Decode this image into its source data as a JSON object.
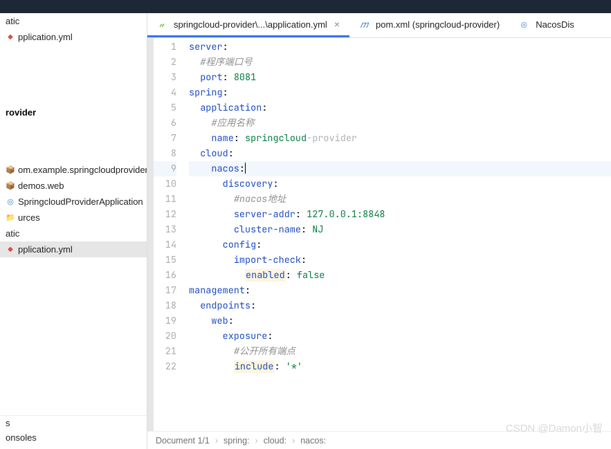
{
  "sidebar": {
    "upper_items": [
      {
        "label": "atic",
        "class": ""
      },
      {
        "label": "pplication.yml",
        "class": "yml"
      }
    ],
    "heading": "rovider",
    "tree_items": [
      {
        "label": "om.example.springcloudprovider",
        "class": "pkg"
      },
      {
        "label": "demos.web",
        "class": "pkg"
      },
      {
        "label": "SpringcloudProviderApplication",
        "class": "java"
      },
      {
        "label": "urces",
        "class": "folder"
      },
      {
        "label": "atic",
        "class": ""
      },
      {
        "label": "pplication.yml",
        "class": "yml",
        "selected": true
      }
    ],
    "bottom_items": [
      {
        "label": "s"
      },
      {
        "label": "onsoles"
      }
    ]
  },
  "tabs": [
    {
      "label": "springcloud-provider\\...\\application.yml",
      "icon": "yml-green",
      "active": true,
      "closable": true
    },
    {
      "label": "pom.xml (springcloud-provider)",
      "icon": "maven",
      "active": false,
      "closable": false
    },
    {
      "label": "NacosDis",
      "icon": "nacos",
      "active": false,
      "closable": false
    }
  ],
  "code_lines": [
    {
      "n": 1,
      "segs": [
        {
          "t": "k",
          "s": "server"
        },
        {
          "t": "",
          "s": ":"
        }
      ]
    },
    {
      "n": 2,
      "segs": [
        {
          "t": "",
          "s": "  "
        },
        {
          "t": "cmt",
          "s": "#程序端口号"
        }
      ]
    },
    {
      "n": 3,
      "segs": [
        {
          "t": "",
          "s": "  "
        },
        {
          "t": "k",
          "s": "port"
        },
        {
          "t": "",
          "s": ": "
        },
        {
          "t": "v",
          "s": "8081"
        }
      ]
    },
    {
      "n": 4,
      "segs": [
        {
          "t": "k",
          "s": "spring"
        },
        {
          "t": "",
          "s": ":"
        }
      ]
    },
    {
      "n": 5,
      "segs": [
        {
          "t": "",
          "s": "  "
        },
        {
          "t": "k",
          "s": "application"
        },
        {
          "t": "",
          "s": ":"
        }
      ]
    },
    {
      "n": 6,
      "segs": [
        {
          "t": "",
          "s": "    "
        },
        {
          "t": "cmt",
          "s": "#应用名称"
        }
      ]
    },
    {
      "n": 7,
      "segs": [
        {
          "t": "",
          "s": "    "
        },
        {
          "t": "k",
          "s": "name"
        },
        {
          "t": "",
          "s": ": "
        },
        {
          "t": "v",
          "s": "springcloud"
        },
        {
          "t": "hint",
          "s": "-provider"
        }
      ]
    },
    {
      "n": 8,
      "segs": [
        {
          "t": "",
          "s": "  "
        },
        {
          "t": "k",
          "s": "cloud"
        },
        {
          "t": "",
          "s": ":"
        }
      ]
    },
    {
      "n": 9,
      "hl": true,
      "segs": [
        {
          "t": "",
          "s": "    "
        },
        {
          "t": "k",
          "s": "nacos"
        },
        {
          "t": "",
          "s": ":"
        },
        {
          "t": "cursor",
          "s": ""
        }
      ]
    },
    {
      "n": 10,
      "segs": [
        {
          "t": "",
          "s": "      "
        },
        {
          "t": "k",
          "s": "discovery"
        },
        {
          "t": "",
          "s": ":"
        }
      ]
    },
    {
      "n": 11,
      "segs": [
        {
          "t": "",
          "s": "        "
        },
        {
          "t": "cmt",
          "s": "#nacos地址"
        }
      ]
    },
    {
      "n": 12,
      "segs": [
        {
          "t": "",
          "s": "        "
        },
        {
          "t": "k",
          "s": "server-addr"
        },
        {
          "t": "",
          "s": ": "
        },
        {
          "t": "v",
          "s": "127.0.0.1:8848"
        }
      ]
    },
    {
      "n": 13,
      "segs": [
        {
          "t": "",
          "s": "        "
        },
        {
          "t": "k",
          "s": "cluster-name"
        },
        {
          "t": "",
          "s": ": "
        },
        {
          "t": "v",
          "s": "NJ"
        }
      ]
    },
    {
      "n": 14,
      "segs": [
        {
          "t": "",
          "s": "      "
        },
        {
          "t": "k",
          "s": "config"
        },
        {
          "t": "",
          "s": ":"
        }
      ]
    },
    {
      "n": 15,
      "segs": [
        {
          "t": "",
          "s": "        "
        },
        {
          "t": "k",
          "s": "import-check"
        },
        {
          "t": "",
          "s": ":"
        }
      ]
    },
    {
      "n": 16,
      "segs": [
        {
          "t": "",
          "s": "          "
        },
        {
          "t": "k warn",
          "s": "enabled"
        },
        {
          "t": "",
          "s": ": "
        },
        {
          "t": "v",
          "s": "false"
        }
      ]
    },
    {
      "n": 17,
      "segs": [
        {
          "t": "k",
          "s": "management"
        },
        {
          "t": "",
          "s": ":"
        }
      ]
    },
    {
      "n": 18,
      "segs": [
        {
          "t": "",
          "s": "  "
        },
        {
          "t": "k",
          "s": "endpoints"
        },
        {
          "t": "",
          "s": ":"
        }
      ]
    },
    {
      "n": 19,
      "segs": [
        {
          "t": "",
          "s": "    "
        },
        {
          "t": "k",
          "s": "web"
        },
        {
          "t": "",
          "s": ":"
        }
      ]
    },
    {
      "n": 20,
      "segs": [
        {
          "t": "",
          "s": "      "
        },
        {
          "t": "k",
          "s": "exposure"
        },
        {
          "t": "",
          "s": ":"
        }
      ]
    },
    {
      "n": 21,
      "segs": [
        {
          "t": "",
          "s": "        "
        },
        {
          "t": "cmt",
          "s": "#公开所有端点"
        }
      ]
    },
    {
      "n": 22,
      "segs": [
        {
          "t": "",
          "s": "        "
        },
        {
          "t": "k warn",
          "s": "include"
        },
        {
          "t": "",
          "s": ": "
        },
        {
          "t": "v",
          "s": "'*'"
        }
      ]
    }
  ],
  "breadcrumb": {
    "doc": "Document 1/1",
    "path": [
      "spring:",
      "cloud:",
      "nacos:"
    ]
  },
  "watermark": "CSDN @Damon小智"
}
